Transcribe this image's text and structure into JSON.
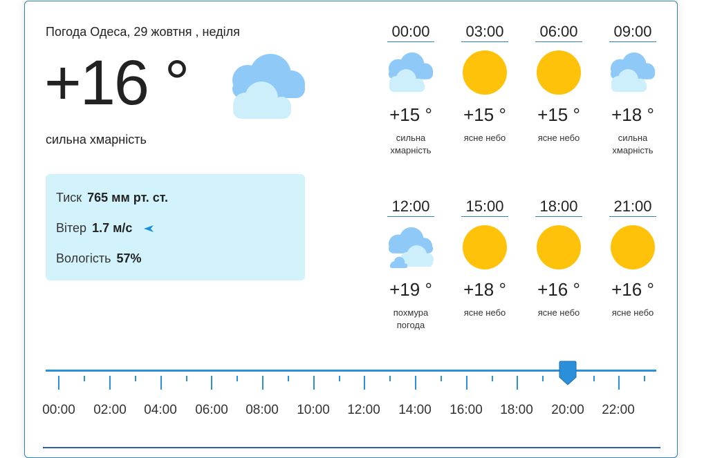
{
  "current": {
    "title": "Погода Одеса, 29 жовтня , неділя",
    "temperature": "+16 °",
    "description": "сильна хмарність",
    "icon": "cloudy-icon",
    "pressure_label": "Тиск",
    "pressure_value": "765 мм рт. ст.",
    "wind_label": "Вітер",
    "wind_value": "1.7 м/с",
    "wind_arrow": "➤",
    "humidity_label": "Вологість",
    "humidity_value": "57%"
  },
  "forecast": [
    {
      "time": "00:00",
      "temp": "+15 °",
      "desc": "сильна хмарність",
      "icon": "cloudy-icon"
    },
    {
      "time": "03:00",
      "temp": "+15 °",
      "desc": "ясне небо",
      "icon": "sun-icon"
    },
    {
      "time": "06:00",
      "temp": "+15 °",
      "desc": "ясне небо",
      "icon": "sun-icon"
    },
    {
      "time": "09:00",
      "temp": "+18 °",
      "desc": "сильна хмарність",
      "icon": "cloudy-icon"
    },
    {
      "time": "12:00",
      "temp": "+19 °",
      "desc": "похмура погода",
      "icon": "overcast-icon"
    },
    {
      "time": "15:00",
      "temp": "+18 °",
      "desc": "ясне небо",
      "icon": "sun-icon"
    },
    {
      "time": "18:00",
      "temp": "+16 °",
      "desc": "ясне небо",
      "icon": "sun-icon"
    },
    {
      "time": "21:00",
      "temp": "+16 °",
      "desc": "ясне небо",
      "icon": "sun-icon"
    }
  ],
  "timeline": {
    "labels": [
      "00:00",
      "02:00",
      "04:00",
      "06:00",
      "08:00",
      "10:00",
      "12:00",
      "14:00",
      "16:00",
      "18:00",
      "20:00",
      "22:00"
    ],
    "selected": "20:00",
    "accent": "#2c8fd9"
  },
  "colors": {
    "sun": "#ffc20a",
    "cloud_back": "#8ec9f7",
    "cloud_front": "#cdeffb",
    "info_bg": "#d3f3fc"
  }
}
